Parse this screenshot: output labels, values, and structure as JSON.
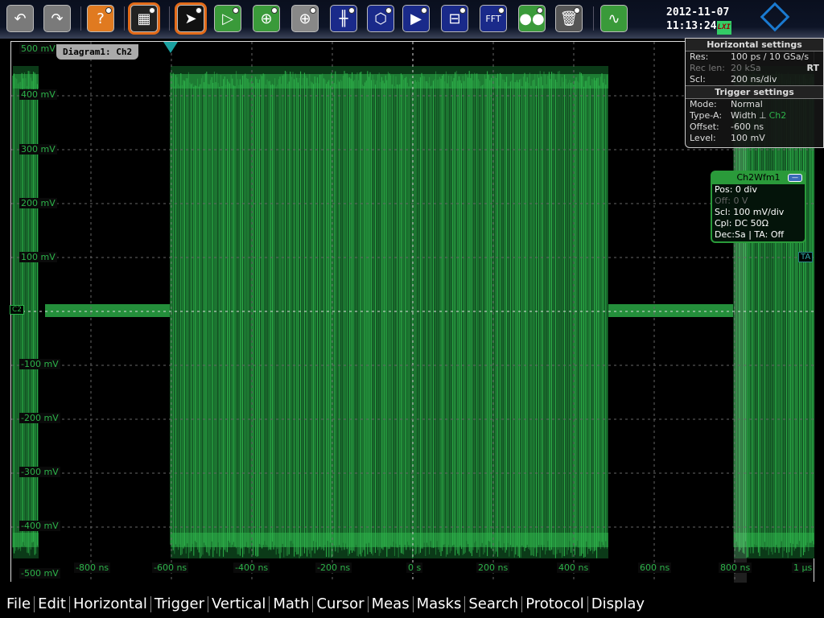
{
  "toolbar": {
    "buttons": [
      {
        "name": "undo-icon",
        "bg": "#7a7a7a",
        "glyph": "↶"
      },
      {
        "name": "redo-icon",
        "bg": "#7a7a7a",
        "glyph": "↷"
      },
      {
        "name": "help-icon",
        "bg": "#e07a20",
        "glyph": "?"
      },
      {
        "name": "grid-layout-icon",
        "bg": "#222",
        "glyph": "▦"
      },
      {
        "name": "pointer-icon",
        "bg": "#111",
        "glyph": "➤"
      },
      {
        "name": "amplifier-icon",
        "bg": "#3a9a3a",
        "glyph": "▷"
      },
      {
        "name": "zoom-in-icon",
        "bg": "#3a9a3a",
        "glyph": "⊕"
      },
      {
        "name": "multi-zoom-icon",
        "bg": "#888",
        "glyph": "⊕"
      },
      {
        "name": "cursor-icon",
        "bg": "#1a2a8a",
        "glyph": "╫"
      },
      {
        "name": "mask-icon",
        "bg": "#1a2a8a",
        "glyph": "⬡"
      },
      {
        "name": "trigger-icon",
        "bg": "#1a2a8a",
        "glyph": "▶"
      },
      {
        "name": "measure-icon",
        "bg": "#1a2a8a",
        "glyph": "⊟"
      },
      {
        "name": "fft-icon",
        "bg": "#1a2a8a",
        "glyph": "FFT"
      },
      {
        "name": "search-binoculars-icon",
        "bg": "#3a9a3a",
        "glyph": "●●"
      },
      {
        "name": "delete-icon",
        "bg": "#555",
        "glyph": "🗑"
      },
      {
        "name": "waveform-icon",
        "bg": "#3a9a3a",
        "glyph": "∿"
      }
    ]
  },
  "status": {
    "date": "2012-11-07",
    "time": "11:13:24",
    "lxi": "LXI",
    "logo": "R&S"
  },
  "diagram": {
    "tab": "Diagram1: Ch2",
    "channel_marker": "C2",
    "trigger_marker": "TA",
    "y_labels": [
      "500 mV",
      "400 mV",
      "300 mV",
      "200 mV",
      "100 mV",
      "-100 mV",
      "-200 mV",
      "-300 mV",
      "-400 mV",
      "-500 mV"
    ],
    "x_labels": [
      "-800 ns",
      "-600 ns",
      "-400 ns",
      "-200 ns",
      "0 s",
      "200 ns",
      "400 ns",
      "600 ns",
      "800 ns",
      "1 µs"
    ],
    "trace_color": "#2db34a"
  },
  "horizontal": {
    "title": "Horizontal settings",
    "res_k": "Res:",
    "res": "100 ps / 10 GSa/s",
    "rec_k": "Rec len:",
    "rec": "20 kSa",
    "rt": "RT",
    "scl_k": "Scl:",
    "scl": "200 ns/div"
  },
  "trigger": {
    "title": "Trigger settings",
    "mode_k": "Mode:",
    "mode": "Normal",
    "type_k": "Type-A:",
    "type": "Width",
    "source": "Ch2",
    "offset_k": "Offset:",
    "offset": "-600 ns",
    "level_k": "Level:",
    "level": "100 mV"
  },
  "waveform": {
    "title": "Ch2Wfm1",
    "pos": "Pos: 0 div",
    "off": "Off: 0 V",
    "scl": "Scl: 100 mV/div",
    "cpl": "Cpl: DC 50Ω",
    "dec": "Dec:Sa | TA: Off"
  },
  "menu": [
    "File",
    "Edit",
    "Horizontal",
    "Trigger",
    "Vertical",
    "Math",
    "Cursor",
    "Meas",
    "Masks",
    "Search",
    "Protocol",
    "Display"
  ]
}
